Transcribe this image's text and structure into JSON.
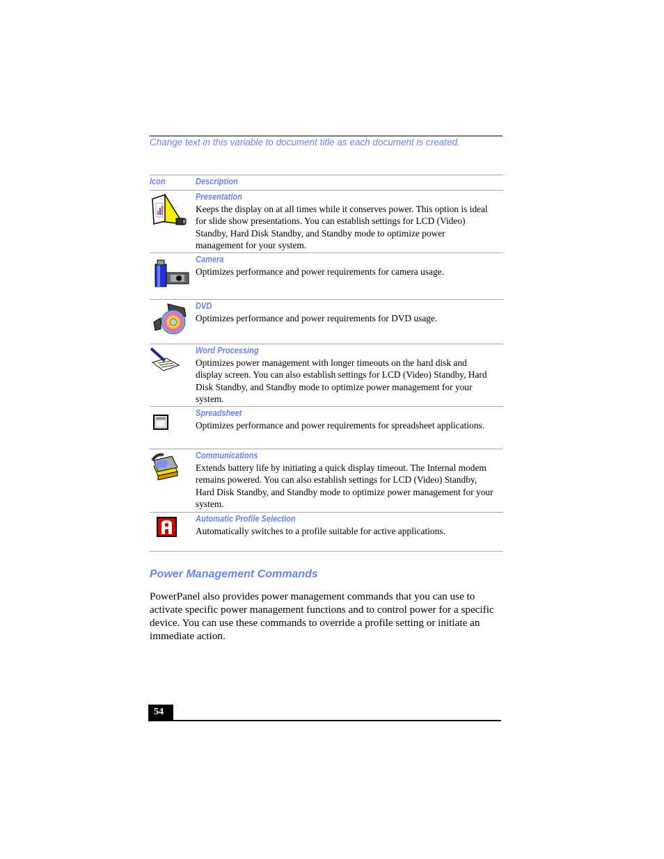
{
  "header": {
    "doc_title_variable": "Change text in this variable to document title as each document is created."
  },
  "table": {
    "columns": [
      "Icon",
      "Description"
    ],
    "rows": [
      {
        "icon": "presentation-icon",
        "label": "Presentation",
        "description": "Keeps the display on at all times while it conserves power. This option is ideal for slide show presentations. You can establish settings for LCD (Video) Standby, Hard Disk Standby, and Standby mode to optimize power management for your system."
      },
      {
        "icon": "camera-icon",
        "label": "Camera",
        "description": "Optimizes performance and power requirements for camera usage."
      },
      {
        "icon": "dvd-icon",
        "label": "DVD",
        "description": "Optimizes performance and power requirements for DVD usage."
      },
      {
        "icon": "word-processing-icon",
        "label": "Word Processing",
        "description": "Optimizes power management with longer timeouts on the hard disk and display screen. You can also establish settings for LCD (Video) Standby, Hard Disk Standby, and Standby mode to optimize power management for your system."
      },
      {
        "icon": "spreadsheet-icon",
        "label": "Spreadsheet",
        "description": "Optimizes performance and power requirements for spreadsheet applications."
      },
      {
        "icon": "communications-icon",
        "label": "Communications",
        "description": "Extends battery life by initiating a quick display timeout. The Internal modem remains powered. You can also establish settings for LCD (Video) Standby, Hard Disk Standby, and Standby mode to optimize power management for your system."
      },
      {
        "icon": "automatic-profile-icon",
        "label": "Automatic Profile Selection",
        "description": "Automatically switches to a profile suitable for active applications."
      }
    ]
  },
  "section": {
    "title": "Power Management Commands",
    "paragraph": "PowerPanel also provides power management commands that you can use to activate specific power management functions and to control power for a specific device. You can use these commands to override a profile setting or initiate an immediate action."
  },
  "footer": {
    "page_number": "54"
  }
}
